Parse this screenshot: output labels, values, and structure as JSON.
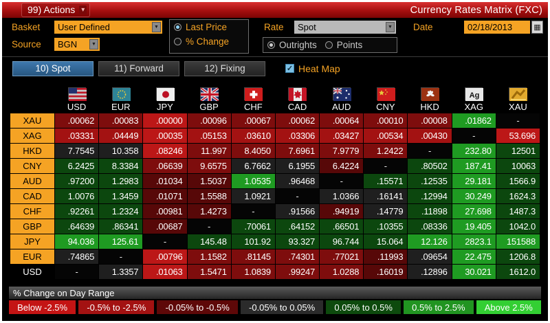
{
  "titlebar": {
    "actions_label": "99) Actions",
    "title": "Currency Rates Matrix (FXC)"
  },
  "controls": {
    "basket_label": "Basket",
    "basket_value": "User Defined",
    "source_label": "Source",
    "source_value": "BGN",
    "price_mode_options": [
      {
        "label": "Last Price",
        "selected": true
      },
      {
        "label": "% Change",
        "selected": false
      }
    ],
    "rate_label": "Rate",
    "rate_value": "Spot",
    "rate_mode_options": [
      {
        "label": "Outrights",
        "selected": true
      },
      {
        "label": "Points",
        "selected": false
      }
    ],
    "date_label": "Date",
    "date_value": "02/18/2013",
    "calendar_icon": "calendar-icon"
  },
  "tabs": [
    {
      "label": "10) Spot",
      "active": true
    },
    {
      "label": "11) Forward",
      "active": false
    },
    {
      "label": "12) Fixing",
      "active": false
    }
  ],
  "heatmap_toggle": {
    "label": "Heat Map",
    "checked": true
  },
  "palette": {
    "r1": "#bc1717",
    "r2": "#a31212",
    "r3": "#7e0d0d",
    "r4": "#570808",
    "k": "#1f1f1f",
    "d": "#050505",
    "g1": "#0c470e",
    "g2": "#1f9b22",
    "accent_amber": "#f5a324",
    "tab_active_blue": "#2f6795"
  },
  "matrix": {
    "columns": [
      {
        "code": "USD",
        "flag": "usd"
      },
      {
        "code": "EUR",
        "flag": "eur"
      },
      {
        "code": "JPY",
        "flag": "jpy"
      },
      {
        "code": "GBP",
        "flag": "gbp"
      },
      {
        "code": "CHF",
        "flag": "chf"
      },
      {
        "code": "CAD",
        "flag": "cad"
      },
      {
        "code": "AUD",
        "flag": "aud"
      },
      {
        "code": "CNY",
        "flag": "cny"
      },
      {
        "code": "HKD",
        "flag": "hkd"
      },
      {
        "code": "XAG",
        "flag": "xag"
      },
      {
        "code": "XAU",
        "flag": "xau"
      }
    ],
    "rows": [
      {
        "code": "XAU",
        "highlight": true,
        "cells": [
          {
            "v": ".00062",
            "c": "r3"
          },
          {
            "v": ".00083",
            "c": "r3"
          },
          {
            "v": ".00000",
            "c": "r1"
          },
          {
            "v": ".00096",
            "c": "r3"
          },
          {
            "v": ".00067",
            "c": "r3"
          },
          {
            "v": ".00062",
            "c": "r3"
          },
          {
            "v": ".00064",
            "c": "r3"
          },
          {
            "v": ".00010",
            "c": "r3"
          },
          {
            "v": ".00008",
            "c": "r3"
          },
          {
            "v": ".01862",
            "c": "g2"
          },
          {
            "v": "-",
            "c": "d"
          }
        ]
      },
      {
        "code": "XAG",
        "highlight": true,
        "cells": [
          {
            "v": ".03331",
            "c": "r2"
          },
          {
            "v": ".04449",
            "c": "r2"
          },
          {
            "v": ".00035",
            "c": "r1"
          },
          {
            "v": ".05153",
            "c": "r2"
          },
          {
            "v": ".03610",
            "c": "r2"
          },
          {
            "v": ".03306",
            "c": "r2"
          },
          {
            "v": ".03427",
            "c": "r2"
          },
          {
            "v": ".00534",
            "c": "r2"
          },
          {
            "v": ".00430",
            "c": "r2"
          },
          {
            "v": "-",
            "c": "d"
          },
          {
            "v": "53.696",
            "c": "r1"
          }
        ]
      },
      {
        "code": "HKD",
        "highlight": true,
        "cells": [
          {
            "v": "7.7545",
            "c": "k"
          },
          {
            "v": "10.358",
            "c": "k"
          },
          {
            "v": ".08246",
            "c": "r1"
          },
          {
            "v": "11.997",
            "c": "r3"
          },
          {
            "v": "8.4050",
            "c": "r3"
          },
          {
            "v": "7.6961",
            "c": "r3"
          },
          {
            "v": "7.9779",
            "c": "r3"
          },
          {
            "v": "1.2422",
            "c": "r3"
          },
          {
            "v": "-",
            "c": "d"
          },
          {
            "v": "232.80",
            "c": "g2"
          },
          {
            "v": "12501",
            "c": "g1"
          }
        ]
      },
      {
        "code": "CNY",
        "highlight": true,
        "cells": [
          {
            "v": "6.2425",
            "c": "g1"
          },
          {
            "v": "8.3384",
            "c": "g1"
          },
          {
            "v": ".06639",
            "c": "r3"
          },
          {
            "v": "9.6575",
            "c": "r3"
          },
          {
            "v": "6.7662",
            "c": "k"
          },
          {
            "v": "6.1955",
            "c": "k"
          },
          {
            "v": "6.4224",
            "c": "r4"
          },
          {
            "v": "-",
            "c": "d"
          },
          {
            "v": ".80502",
            "c": "g1"
          },
          {
            "v": "187.41",
            "c": "g2"
          },
          {
            "v": "10063",
            "c": "g1"
          }
        ]
      },
      {
        "code": "AUD",
        "highlight": true,
        "cells": [
          {
            "v": ".97200",
            "c": "g1"
          },
          {
            "v": "1.2983",
            "c": "g1"
          },
          {
            "v": ".01034",
            "c": "r4"
          },
          {
            "v": "1.5037",
            "c": "r4"
          },
          {
            "v": "1.0535",
            "c": "g2"
          },
          {
            "v": ".96468",
            "c": "k"
          },
          {
            "v": "-",
            "c": "d"
          },
          {
            "v": ".15571",
            "c": "g1"
          },
          {
            "v": ".12535",
            "c": "g1"
          },
          {
            "v": "29.181",
            "c": "g2"
          },
          {
            "v": "1566.9",
            "c": "g1"
          }
        ]
      },
      {
        "code": "CAD",
        "highlight": true,
        "cells": [
          {
            "v": "1.0076",
            "c": "g1"
          },
          {
            "v": "1.3459",
            "c": "g1"
          },
          {
            "v": ".01071",
            "c": "r4"
          },
          {
            "v": "1.5588",
            "c": "r4"
          },
          {
            "v": "1.0921",
            "c": "k"
          },
          {
            "v": "-",
            "c": "d"
          },
          {
            "v": "1.0366",
            "c": "k"
          },
          {
            "v": ".16141",
            "c": "k"
          },
          {
            "v": ".12994",
            "c": "g1"
          },
          {
            "v": "30.249",
            "c": "g2"
          },
          {
            "v": "1624.3",
            "c": "g1"
          }
        ]
      },
      {
        "code": "CHF",
        "highlight": true,
        "cells": [
          {
            "v": ".92261",
            "c": "g1"
          },
          {
            "v": "1.2324",
            "c": "g1"
          },
          {
            "v": ".00981",
            "c": "r4"
          },
          {
            "v": "1.4273",
            "c": "r4"
          },
          {
            "v": "-",
            "c": "d"
          },
          {
            "v": ".91566",
            "c": "k"
          },
          {
            "v": ".94919",
            "c": "r4"
          },
          {
            "v": ".14779",
            "c": "k"
          },
          {
            "v": ".11898",
            "c": "g1"
          },
          {
            "v": "27.698",
            "c": "g2"
          },
          {
            "v": "1487.3",
            "c": "g1"
          }
        ]
      },
      {
        "code": "GBP",
        "highlight": true,
        "cells": [
          {
            "v": ".64639",
            "c": "g1"
          },
          {
            "v": ".86341",
            "c": "g1"
          },
          {
            "v": ".00687",
            "c": "r4"
          },
          {
            "v": "-",
            "c": "d"
          },
          {
            "v": ".70061",
            "c": "g1"
          },
          {
            "v": ".64152",
            "c": "g1"
          },
          {
            "v": ".66501",
            "c": "g1"
          },
          {
            "v": ".10355",
            "c": "g1"
          },
          {
            "v": ".08336",
            "c": "g1"
          },
          {
            "v": "19.405",
            "c": "g2"
          },
          {
            "v": "1042.0",
            "c": "g1"
          }
        ]
      },
      {
        "code": "JPY",
        "highlight": true,
        "cells": [
          {
            "v": "94.036",
            "c": "g2"
          },
          {
            "v": "125.61",
            "c": "g2"
          },
          {
            "v": "-",
            "c": "d"
          },
          {
            "v": "145.48",
            "c": "g1"
          },
          {
            "v": "101.92",
            "c": "g1"
          },
          {
            "v": "93.327",
            "c": "g1"
          },
          {
            "v": "96.744",
            "c": "g1"
          },
          {
            "v": "15.064",
            "c": "g1"
          },
          {
            "v": "12.126",
            "c": "g2"
          },
          {
            "v": "2823.1",
            "c": "g2"
          },
          {
            "v": "151588",
            "c": "g2"
          }
        ]
      },
      {
        "code": "EUR",
        "highlight": true,
        "cells": [
          {
            "v": ".74865",
            "c": "k"
          },
          {
            "v": "-",
            "c": "d"
          },
          {
            "v": ".00796",
            "c": "r1"
          },
          {
            "v": "1.1582",
            "c": "r3"
          },
          {
            "v": ".81145",
            "c": "r3"
          },
          {
            "v": ".74301",
            "c": "r3"
          },
          {
            "v": ".77021",
            "c": "r3"
          },
          {
            "v": ".11993",
            "c": "r4"
          },
          {
            "v": ".09654",
            "c": "k"
          },
          {
            "v": "22.475",
            "c": "g2"
          },
          {
            "v": "1206.8",
            "c": "g1"
          }
        ]
      },
      {
        "code": "USD",
        "highlight": false,
        "cells": [
          {
            "v": "-",
            "c": "d"
          },
          {
            "v": "1.3357",
            "c": "k"
          },
          {
            "v": ".01063",
            "c": "r1"
          },
          {
            "v": "1.5471",
            "c": "r3"
          },
          {
            "v": "1.0839",
            "c": "r3"
          },
          {
            "v": ".99247",
            "c": "r3"
          },
          {
            "v": "1.0288",
            "c": "r3"
          },
          {
            "v": ".16019",
            "c": "r4"
          },
          {
            "v": ".12896",
            "c": "k"
          },
          {
            "v": "30.021",
            "c": "g2"
          },
          {
            "v": "1612.0",
            "c": "g1"
          }
        ]
      }
    ]
  },
  "legend": {
    "title": "% Change on Day Range",
    "buckets": [
      {
        "label": "Below -2.5%",
        "color": "#c41414"
      },
      {
        "label": "-0.5% to -2.5%",
        "color": "#a31212"
      },
      {
        "label": "-0.05% to -0.5%",
        "color": "#5e0808"
      },
      {
        "label": "-0.05% to 0.05%",
        "color": "#2b2b2b"
      },
      {
        "label": "0.05% to 0.5%",
        "color": "#0d4a0d"
      },
      {
        "label": "0.5% to 2.5%",
        "color": "#219421"
      },
      {
        "label": "Above 2.5%",
        "color": "#33cf33"
      }
    ]
  }
}
